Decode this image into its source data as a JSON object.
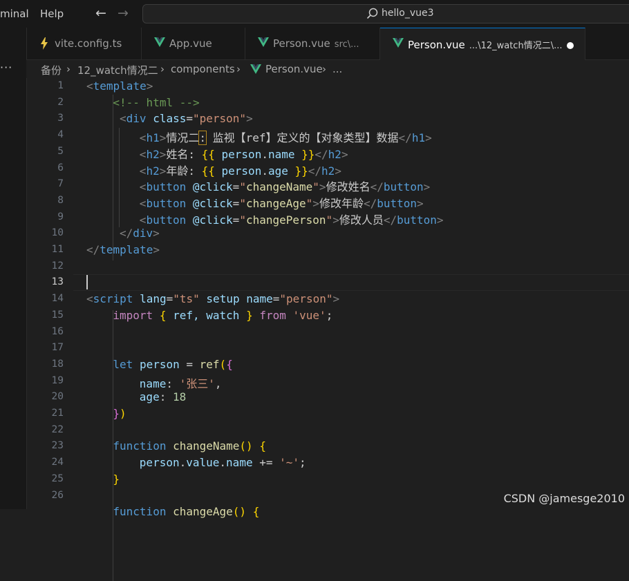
{
  "menu": {
    "terminal": "minal",
    "help": "Help"
  },
  "nav": {
    "back": "←",
    "forward": "→"
  },
  "search": {
    "text": "hello_vue3"
  },
  "more": "···",
  "tabs": [
    {
      "label": "vite.config.ts",
      "desc": "",
      "icon": "typescript-config-icon"
    },
    {
      "label": "App.vue",
      "desc": "",
      "icon": "vue-icon"
    },
    {
      "label": "Person.vue",
      "desc": "src\\...",
      "icon": "vue-icon"
    },
    {
      "label": "Person.vue",
      "desc": "...\\12_watch情况二\\...",
      "icon": "vue-icon",
      "active": true,
      "modified": true
    }
  ],
  "breadcrumb": [
    "备份",
    "12_watch情况二",
    "components",
    "Person.vue",
    "..."
  ],
  "line_numbers": [
    "1",
    "2",
    "3",
    "4",
    "5",
    "6",
    "7",
    "8",
    "9",
    "10",
    "11",
    "12",
    "13",
    "14",
    "15",
    "16",
    "17",
    "18",
    "19",
    "20",
    "21",
    "22",
    "23",
    "24",
    "25",
    "26"
  ],
  "current_line": 13,
  "code": {
    "l1": [
      "<",
      "template",
      ">"
    ],
    "l2": "<!-- html -->",
    "l3": [
      "<",
      "div",
      "class",
      "=",
      "\"person\"",
      ">"
    ],
    "l4": [
      "<",
      "h1",
      ">",
      "情况二",
      ":",
      " 监视【ref】定义的【对象类型】数据",
      "</",
      "h1",
      ">"
    ],
    "l5": [
      "<",
      "h2",
      ">",
      "姓名: ",
      "{{",
      " person",
      ".",
      "name",
      " }}",
      "</",
      "h2",
      ">"
    ],
    "l6": [
      "<",
      "h2",
      ">",
      "年龄: ",
      "{{",
      " person",
      ".",
      "age",
      " }}",
      "</",
      "h2",
      ">"
    ],
    "l7": [
      "<",
      "button",
      "@click",
      "=",
      "\"",
      "changeName",
      "\"",
      ">",
      "修改姓名",
      "</",
      "button",
      ">"
    ],
    "l8": [
      "<",
      "button",
      "@click",
      "=",
      "\"",
      "changeAge",
      "\"",
      ">",
      "修改年龄",
      "</",
      "button",
      ">"
    ],
    "l9": [
      "<",
      "button",
      "@click",
      "=",
      "\"",
      "changePerson",
      "\"",
      ">",
      "修改人员",
      "</",
      "button",
      ">"
    ],
    "l10": [
      "</",
      "div",
      ">"
    ],
    "l11": [
      "</",
      "template",
      ">"
    ],
    "l14": [
      "<",
      "script",
      "lang",
      "=",
      "\"ts\"",
      "setup",
      "name",
      "=",
      "\"person\"",
      ">"
    ],
    "l15": [
      "import",
      "{",
      " ref, watch ",
      "}",
      "from",
      "'vue'",
      ";"
    ],
    "l18": [
      "let",
      "person",
      " = ",
      "ref",
      "(",
      "{"
    ],
    "l19": [
      "name",
      ": ",
      "'张三'",
      ","
    ],
    "l20": [
      "age",
      ": ",
      "18"
    ],
    "l21": [
      "}",
      ")"
    ],
    "l23": [
      "function",
      "changeName",
      "()",
      " {"
    ],
    "l24": [
      "person",
      ".",
      "value",
      ".",
      "name",
      " += ",
      "'~'",
      ";"
    ],
    "l25": [
      "}"
    ],
    "l27": [
      "function",
      "changeAge",
      "()",
      " {"
    ]
  },
  "watermark": "CSDN @jamesge2010",
  "colors": {
    "vue": "#41b883",
    "config": "#e8c547",
    "accent": "#0078d4"
  }
}
